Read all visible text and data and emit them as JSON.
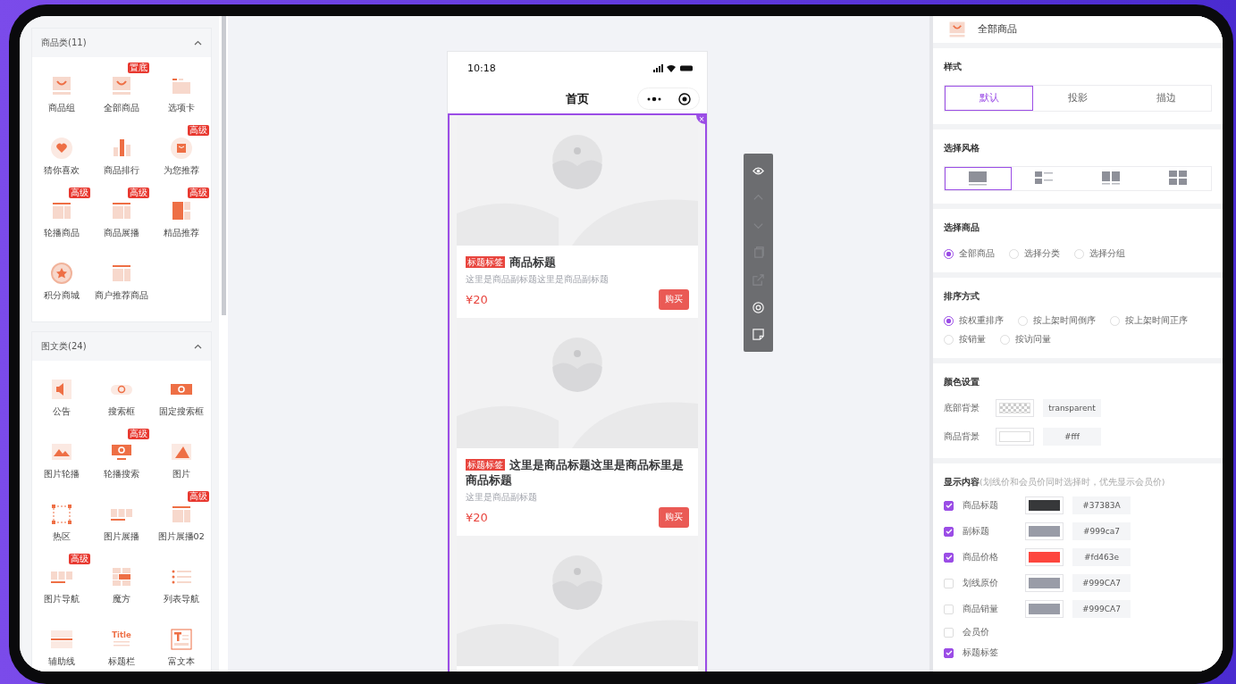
{
  "left_panel": {
    "sections": [
      {
        "title": "商品类(11)",
        "expanded": true,
        "items": [
          {
            "label": "商品组"
          },
          {
            "label": "全部商品",
            "badge": "置底"
          },
          {
            "label": "选项卡"
          },
          {
            "label": "猜你喜欢"
          },
          {
            "label": "商品排行"
          },
          {
            "label": "为您推荐",
            "badge": "高级"
          },
          {
            "label": "轮播商品",
            "badge": "高级"
          },
          {
            "label": "商品展播",
            "badge": "高级"
          },
          {
            "label": "精品推荐",
            "badge": "高级"
          },
          {
            "label": "积分商城"
          },
          {
            "label": "商户推荐商品"
          }
        ]
      },
      {
        "title": "图文类(24)",
        "expanded": true,
        "items": [
          {
            "label": "公告"
          },
          {
            "label": "搜索框"
          },
          {
            "label": "固定搜索框"
          },
          {
            "label": "图片轮播"
          },
          {
            "label": "轮播搜索",
            "badge": "高级"
          },
          {
            "label": "图片"
          },
          {
            "label": "热区"
          },
          {
            "label": "图片展播"
          },
          {
            "label": "图片展播02",
            "badge": "高级"
          },
          {
            "label": "图片导航",
            "badge": "高级"
          },
          {
            "label": "魔方"
          },
          {
            "label": "列表导航"
          },
          {
            "label": "辅助线"
          },
          {
            "label": "标题栏",
            "icon_text": "Title"
          },
          {
            "label": "富文本"
          }
        ]
      }
    ]
  },
  "phone": {
    "time": "10:18",
    "nav_title": "首页",
    "close": "×",
    "products": [
      {
        "tag": "标题标签",
        "title": "商品标题",
        "subtitle": "这里是商品副标题这里是商品副标题",
        "price": "¥20",
        "buy": "购买"
      },
      {
        "tag": "标题标签",
        "title": "这里是商品标题这里是商品标里是商品标题",
        "subtitle": "这里是商品副标题",
        "price": "¥20",
        "buy": "购买"
      }
    ]
  },
  "tools": [
    {
      "disabled": false
    },
    {
      "disabled": true
    },
    {
      "disabled": true
    },
    {
      "disabled": true
    },
    {
      "disabled": true
    },
    {
      "disabled": false
    },
    {
      "disabled": false
    }
  ],
  "settings": {
    "header": "全部商品",
    "style": {
      "title": "样式",
      "options": [
        {
          "label": "默认",
          "selected": true
        },
        {
          "label": "投影",
          "selected": false
        },
        {
          "label": "描边",
          "selected": false
        }
      ]
    },
    "layout": {
      "title": "选择风格",
      "options": [
        {
          "selected": true
        },
        {
          "selected": false
        },
        {
          "selected": false
        },
        {
          "selected": false
        }
      ]
    },
    "goods": {
      "title": "选择商品",
      "options": [
        {
          "label": "全部商品",
          "selected": true
        },
        {
          "label": "选择分类",
          "selected": false
        },
        {
          "label": "选择分组",
          "selected": false
        }
      ]
    },
    "sort": {
      "title": "排序方式",
      "options": [
        {
          "label": "按权重排序",
          "selected": true
        },
        {
          "label": "按上架时间倒序",
          "selected": false
        },
        {
          "label": "按上架时间正序",
          "selected": false
        },
        {
          "label": "按销量",
          "selected": false
        },
        {
          "label": "按访问量",
          "selected": false
        }
      ]
    },
    "colors": {
      "title": "颜色设置",
      "rows": [
        {
          "label": "底部背景",
          "kind": "transparent",
          "value": "transparent"
        },
        {
          "label": "商品背景",
          "kind": "solid",
          "color": "#ffffff",
          "value": "#fff"
        }
      ]
    },
    "display": {
      "title": "显示内容",
      "hint": "(划线价和会员价同时选择时，优先显示会员价)",
      "rows": [
        {
          "label": "商品标题",
          "checked": true,
          "color": "#37383a",
          "value": "#37383A"
        },
        {
          "label": "副标题",
          "checked": true,
          "color": "#999ca7",
          "value": "#999ca7"
        },
        {
          "label": "商品价格",
          "checked": true,
          "color": "#fd463e",
          "value": "#fd463e"
        },
        {
          "label": "划线原价",
          "checked": false,
          "color": "#999ca7",
          "value": "#999CA7"
        },
        {
          "label": "商品销量",
          "checked": false,
          "color": "#999ca7",
          "value": "#999CA7"
        },
        {
          "label": "会员价",
          "checked": false
        },
        {
          "label": "标题标签",
          "checked": true
        }
      ]
    }
  }
}
